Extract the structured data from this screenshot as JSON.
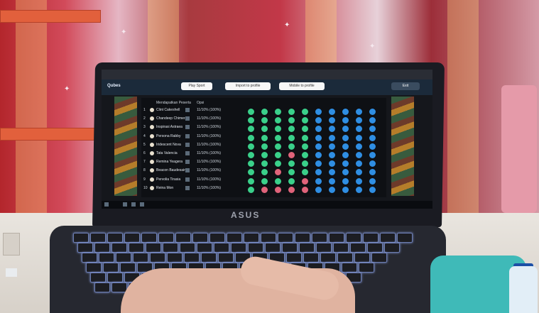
{
  "screen": {
    "app_logo": "Qubes",
    "header_buttons": [
      "Play Sport",
      "Import to profile",
      "Mobile to profile"
    ],
    "header_right_button": "Exit",
    "columns": [
      "Mendapatkan Peserta",
      "Opsi"
    ],
    "rows": [
      {
        "n": "1",
        "name": "Clint Cakeshell",
        "status": "11/10% (100%)"
      },
      {
        "n": "2",
        "name": "Chandeep Chimera",
        "status": "11/10% (100%)"
      },
      {
        "n": "3",
        "name": "Inspirasi Astraea",
        "status": "11/10% (100%)"
      },
      {
        "n": "4",
        "name": "Persona Rabby",
        "status": "11/10% (100%)"
      },
      {
        "n": "5",
        "name": "Iridescent Nova",
        "status": "11/10% (100%)"
      },
      {
        "n": "6",
        "name": "Tata Valencia",
        "status": "11/10% (100%)"
      },
      {
        "n": "7",
        "name": "Remina Yeagera",
        "status": "11/10% (100%)"
      },
      {
        "n": "8",
        "name": "Beacon Baudesain",
        "status": "11/10% (100%)"
      },
      {
        "n": "9",
        "name": "Pervolia Tirasia",
        "status": "11/10% (100%)"
      },
      {
        "n": "10",
        "name": "Reina Mon",
        "status": "11/10% (100%)"
      }
    ],
    "dot_colors": {
      "green": "#3ad08a",
      "blue": "#2f8ee3",
      "red": "#e0637a"
    },
    "grid": [
      [
        "green",
        "green",
        "green",
        "green",
        "green",
        "blue",
        "blue",
        "blue",
        "blue",
        "blue"
      ],
      [
        "green",
        "green",
        "green",
        "green",
        "green",
        "blue",
        "blue",
        "blue",
        "blue",
        "blue"
      ],
      [
        "green",
        "green",
        "green",
        "green",
        "green",
        "blue",
        "blue",
        "blue",
        "blue",
        "blue"
      ],
      [
        "green",
        "green",
        "green",
        "green",
        "green",
        "blue",
        "blue",
        "blue",
        "blue",
        "blue"
      ],
      [
        "green",
        "green",
        "green",
        "green",
        "green",
        "blue",
        "blue",
        "blue",
        "blue",
        "blue"
      ],
      [
        "green",
        "green",
        "green",
        "red",
        "green",
        "blue",
        "blue",
        "blue",
        "blue",
        "blue"
      ],
      [
        "green",
        "green",
        "green",
        "green",
        "green",
        "blue",
        "blue",
        "blue",
        "blue",
        "blue"
      ],
      [
        "green",
        "green",
        "red",
        "green",
        "green",
        "blue",
        "blue",
        "blue",
        "blue",
        "blue"
      ],
      [
        "green",
        "green",
        "green",
        "green",
        "red",
        "blue",
        "blue",
        "blue",
        "blue",
        "blue"
      ],
      [
        "green",
        "red",
        "red",
        "red",
        "red",
        "blue",
        "blue",
        "blue",
        "blue",
        "blue"
      ]
    ]
  },
  "laptop": {
    "brand": "ASUS"
  }
}
